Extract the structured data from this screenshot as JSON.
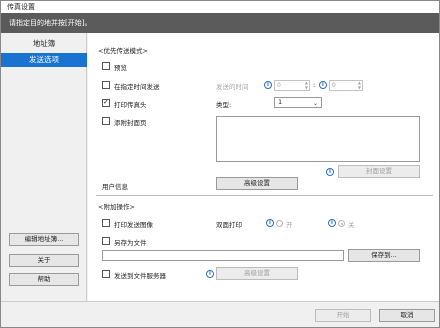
{
  "window": {
    "title": "传真设置"
  },
  "instruction": "请指定目的地并按[开始]。",
  "sidebar": {
    "header": "地址簿",
    "selected_item": "发送选项",
    "edit_address_button": "编辑地址簿...",
    "about_button": "关于",
    "help_button": "帮助"
  },
  "priority_section": {
    "title": "<优先传送模式>",
    "preview_label": "预览",
    "preview_checked": false,
    "scheduled_label": "在指定时间发送",
    "scheduled_checked": false,
    "send_time_label": "发送的时间",
    "hour_value": "0",
    "time_separator": ":",
    "minute_value": "0",
    "print_header_label": "打印传真头",
    "print_header_checked": true,
    "type_label": "类型:",
    "type_value": "1",
    "cover_page_label": "添附封面页",
    "cover_page_checked": false,
    "cover_settings_button": "封面设置",
    "user_info_label": "用户信息",
    "advanced_settings_button": "高级设置"
  },
  "additional_section": {
    "title": "<附加操作>",
    "print_sent_label": "打印发送图像",
    "print_sent_checked": false,
    "duplex_label": "双面打印",
    "duplex_on_label": "开",
    "duplex_off_label": "关",
    "duplex_selected": "off",
    "save_as_file_label": "另存为文件",
    "save_as_file_checked": false,
    "file_path_value": "",
    "save_to_button": "保存到...",
    "send_to_server_label": "发送到文件服务器",
    "send_to_server_checked": false,
    "server_advanced_button": "高级设置"
  },
  "footer": {
    "start_button": "开始",
    "cancel_button": "取消"
  },
  "colors": {
    "selection": "#1874d0",
    "instruction_bar": "#5b5b5b",
    "info_icon": "#2a6fc9"
  }
}
